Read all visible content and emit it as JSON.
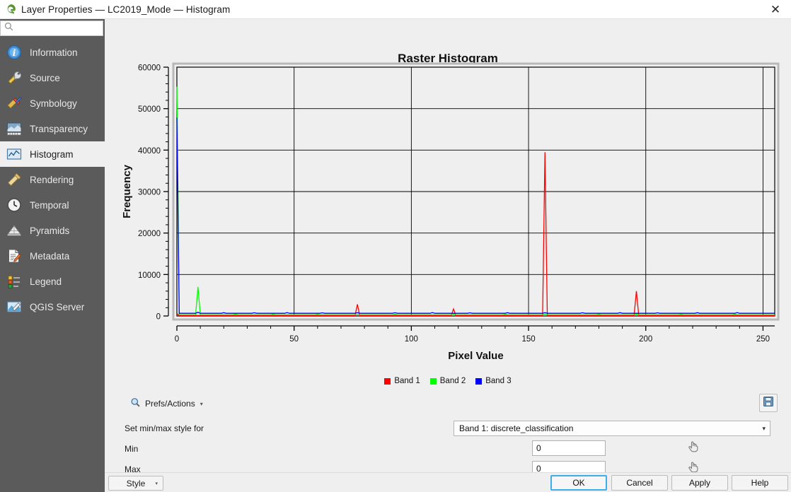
{
  "window": {
    "title": "Layer Properties — LC2019_Mode — Histogram",
    "logo_icon": "qgis-logo-icon",
    "close_icon": "close-icon"
  },
  "sidebar": {
    "search": {
      "value": "",
      "placeholder": "",
      "icon": "search-icon"
    },
    "items": [
      {
        "label": "Information",
        "icon": "information-icon",
        "selected": false
      },
      {
        "label": "Source",
        "icon": "source-icon",
        "selected": false
      },
      {
        "label": "Symbology",
        "icon": "symbology-icon",
        "selected": false
      },
      {
        "label": "Transparency",
        "icon": "transparency-icon",
        "selected": false
      },
      {
        "label": "Histogram",
        "icon": "histogram-icon",
        "selected": true
      },
      {
        "label": "Rendering",
        "icon": "rendering-icon",
        "selected": false
      },
      {
        "label": "Temporal",
        "icon": "temporal-icon",
        "selected": false
      },
      {
        "label": "Pyramids",
        "icon": "pyramids-icon",
        "selected": false
      },
      {
        "label": "Metadata",
        "icon": "metadata-icon",
        "selected": false
      },
      {
        "label": "Legend",
        "icon": "legend-icon",
        "selected": false
      },
      {
        "label": "QGIS Server",
        "icon": "qgis-server-icon",
        "selected": false
      }
    ]
  },
  "chart_data": {
    "type": "line",
    "title": "Raster Histogram",
    "xlabel": "Pixel Value",
    "ylabel": "Frequency",
    "xlim": [
      0,
      255
    ],
    "ylim": [
      0,
      60000
    ],
    "xticks": [
      0,
      50,
      100,
      150,
      200,
      250
    ],
    "yticks": [
      0,
      10000,
      20000,
      30000,
      40000,
      50000,
      60000
    ],
    "grid": true,
    "legend_position": "bottom",
    "series": [
      {
        "name": "Band 1",
        "color": "#FF0000",
        "peaks": [
          {
            "x": 0,
            "y": 600
          },
          {
            "x": 77,
            "y": 2800
          },
          {
            "x": 118,
            "y": 1700
          },
          {
            "x": 157,
            "y": 39500
          },
          {
            "x": 196,
            "y": 6000
          }
        ]
      },
      {
        "name": "Band 2",
        "color": "#00FF00",
        "peaks": [
          {
            "x": 0,
            "y": 55300
          },
          {
            "x": 9,
            "y": 7000
          },
          {
            "x": 25,
            "y": 450
          },
          {
            "x": 41,
            "y": 420
          },
          {
            "x": 60,
            "y": 400
          },
          {
            "x": 93,
            "y": 430
          },
          {
            "x": 118,
            "y": 420
          },
          {
            "x": 140,
            "y": 400
          },
          {
            "x": 157,
            "y": 500
          },
          {
            "x": 180,
            "y": 420
          },
          {
            "x": 196,
            "y": 450
          },
          {
            "x": 215,
            "y": 400
          },
          {
            "x": 238,
            "y": 420
          }
        ]
      },
      {
        "name": "Band 3",
        "color": "#0000FF",
        "peaks": [
          {
            "x": 0,
            "y": 47800
          },
          {
            "x": 9,
            "y": 900
          },
          {
            "x": 20,
            "y": 800
          },
          {
            "x": 33,
            "y": 780
          },
          {
            "x": 47,
            "y": 820
          },
          {
            "x": 62,
            "y": 760
          },
          {
            "x": 77,
            "y": 800
          },
          {
            "x": 93,
            "y": 780
          },
          {
            "x": 109,
            "y": 820
          },
          {
            "x": 125,
            "y": 760
          },
          {
            "x": 141,
            "y": 800
          },
          {
            "x": 157,
            "y": 820
          },
          {
            "x": 173,
            "y": 780
          },
          {
            "x": 189,
            "y": 800
          },
          {
            "x": 205,
            "y": 760
          },
          {
            "x": 222,
            "y": 800
          },
          {
            "x": 239,
            "y": 820
          }
        ]
      }
    ],
    "legend": [
      {
        "label": "Band 1",
        "color": "#FF0000"
      },
      {
        "label": "Band 2",
        "color": "#00FF00"
      },
      {
        "label": "Band 3",
        "color": "#0000FF"
      }
    ]
  },
  "controls": {
    "prefs_label": "Prefs/Actions",
    "prefs_icon": "magnifier-prefs-icon",
    "prefs_caret": "▾",
    "save_icon": "save-floppy-icon",
    "minmax_label": "Set min/max style for",
    "band_select": {
      "value": "Band 1: discrete_classification",
      "caret": "▾"
    },
    "min_label": "Min",
    "min_value": "0",
    "max_label": "Max",
    "max_value": "0",
    "picker_icon": "pointer-hand-icon"
  },
  "buttonbar": {
    "style_label": "Style",
    "style_caret": "▾",
    "ok_label": "OK",
    "cancel_label": "Cancel",
    "apply_label": "Apply",
    "help_label": "Help"
  },
  "colors": {
    "accent": "#3daee9",
    "sidebar_bg": "#5b5b5b",
    "panel_bg": "#efefef"
  }
}
